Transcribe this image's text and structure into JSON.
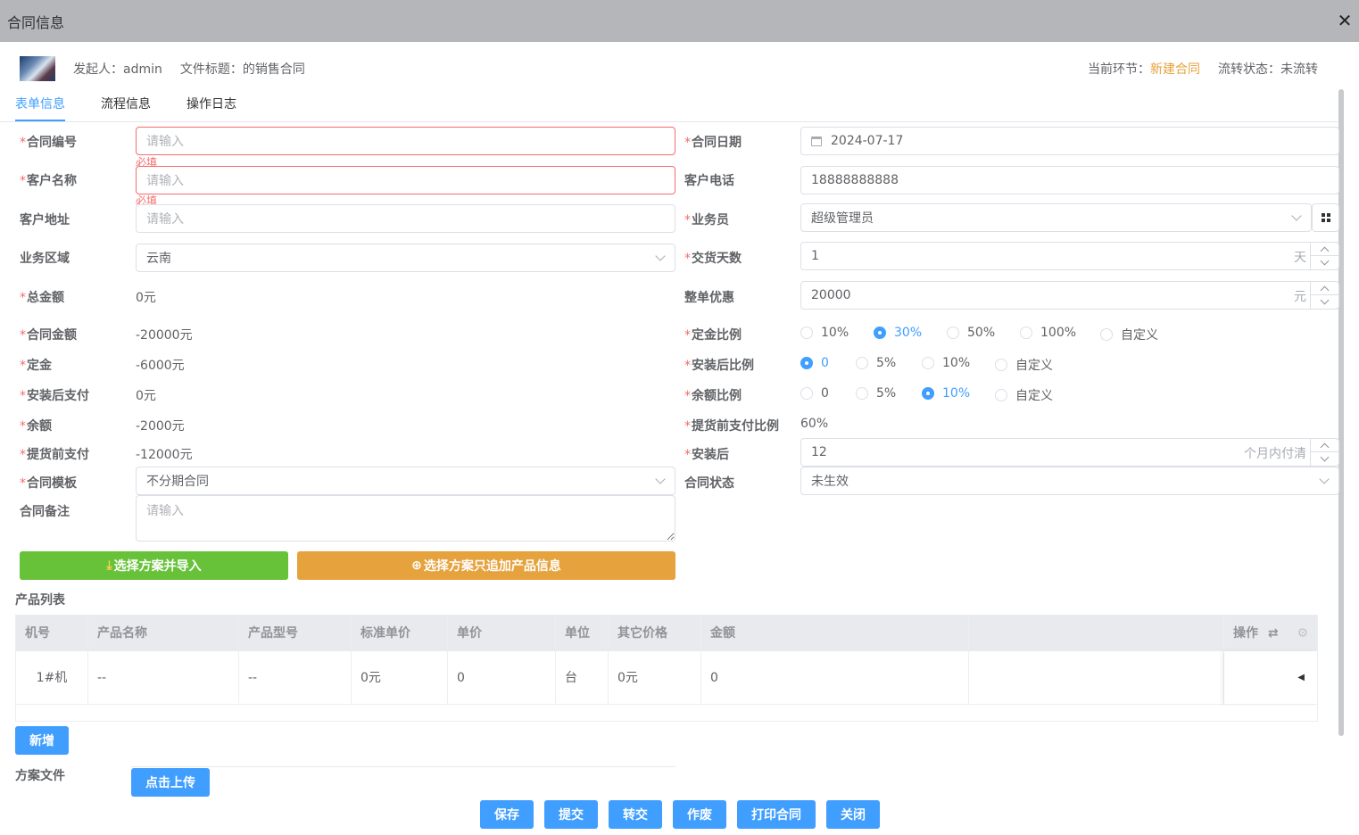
{
  "window": {
    "title": "合同信息",
    "close_icon": "close-icon"
  },
  "header": {
    "initiator": "发起人：admin",
    "doc_title": "文件标题：的销售合同",
    "current_step_label": "当前环节：",
    "current_step_value": "新建合同",
    "flow_status_label": "流转状态：",
    "flow_status_value": "未流转",
    "accent_color": "#e6a23c"
  },
  "tabs": [
    {
      "label": "表单信息",
      "active": true
    },
    {
      "label": "流程信息",
      "active": false
    },
    {
      "label": "操作日志",
      "active": false
    }
  ],
  "form": {
    "contract_no": {
      "label": "合同编号",
      "placeholder": "请输入",
      "error": "必填"
    },
    "customer_name": {
      "label": "客户名称",
      "placeholder": "请输入",
      "error": "必填"
    },
    "customer_addr": {
      "label": "客户地址",
      "placeholder": "请输入"
    },
    "region": {
      "label": "业务区域",
      "value": "云南"
    },
    "total_amount": {
      "label": "总金额",
      "value": "0元"
    },
    "contract_amount": {
      "label": "合同金额",
      "value": "-20000元"
    },
    "deposit": {
      "label": "定金",
      "value": "-6000元"
    },
    "after_install_pay": {
      "label": "安装后支付",
      "value": "0元"
    },
    "balance": {
      "label": "余额",
      "value": "-2000元"
    },
    "before_delivery_pay": {
      "label": "提货前支付",
      "value": "-12000元"
    },
    "template": {
      "label": "合同模板",
      "value": "不分期合同"
    },
    "remark": {
      "label": "合同备注",
      "placeholder": "请输入"
    },
    "contract_date": {
      "label": "合同日期",
      "value": "2024-07-17"
    },
    "customer_phone": {
      "label": "客户电话",
      "value": "18888888888"
    },
    "salesman": {
      "label": "业务员",
      "value": "超级管理员"
    },
    "delivery_days": {
      "label": "交货天数",
      "value": "1",
      "unit": "天"
    },
    "discount": {
      "label": "整单优惠",
      "value": "20000",
      "unit": "元"
    },
    "deposit_ratio": {
      "label": "定金比例",
      "options": [
        "10%",
        "30%",
        "50%",
        "100%",
        "自定义"
      ],
      "selected": 1
    },
    "install_ratio": {
      "label": "安装后比例",
      "options": [
        "0",
        "5%",
        "10%",
        "自定义"
      ],
      "selected": 0
    },
    "balance_ratio": {
      "label": "余额比例",
      "options": [
        "0",
        "5%",
        "10%",
        "自定义"
      ],
      "selected": 2
    },
    "pre_delivery_ratio": {
      "label": "提货前支付比例",
      "value": "60%"
    },
    "after_install": {
      "label": "安装后",
      "value": "12",
      "unit": "个月内付清"
    },
    "contract_status": {
      "label": "合同状态",
      "value": "未生效"
    }
  },
  "actions": {
    "import_scheme": "选择方案并导入",
    "append_products": "选择方案只追加产品信息"
  },
  "products": {
    "title": "产品列表",
    "columns": [
      "机号",
      "产品名称",
      "产品型号",
      "标准单价",
      "单价",
      "单位",
      "其它价格",
      "金额",
      "",
      "操作"
    ],
    "rows": [
      [
        "1#机",
        "--",
        "--",
        "0元",
        "0",
        "台",
        "0元",
        "0",
        ""
      ]
    ],
    "add_label": "新增"
  },
  "files": {
    "label": "方案文件",
    "upload_label": "点击上传"
  },
  "footer": [
    "保存",
    "提交",
    "转交",
    "作废",
    "打印合同",
    "关闭"
  ],
  "colors": {
    "primary": "#409eff",
    "success": "#67c23a",
    "warning": "#e6a23c",
    "danger": "#f56c6c"
  }
}
